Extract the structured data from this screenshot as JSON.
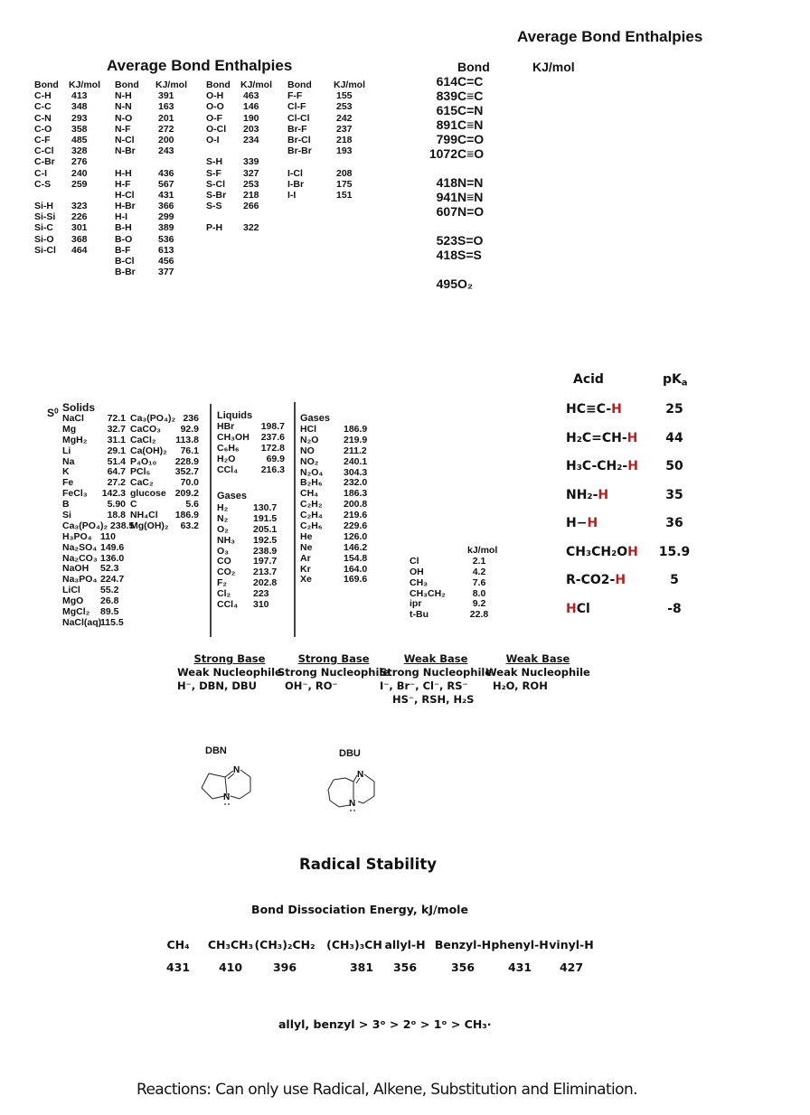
{
  "bond_enthalpies_single": {
    "title": "Average Bond Enthalpies",
    "header_bond": "Bond",
    "header_value": "KJ/mol",
    "columns": [
      {
        "groups": [
          [
            [
              "C-H",
              "413"
            ],
            [
              "C-C",
              "348"
            ],
            [
              "C-N",
              "293"
            ],
            [
              "C-O",
              "358"
            ],
            [
              "C-F",
              "485"
            ],
            [
              "C-Cl",
              "328"
            ],
            [
              "C-Br",
              "276"
            ],
            [
              "C-I",
              "240"
            ],
            [
              "C-S",
              "259"
            ]
          ],
          [
            [
              "Si-H",
              "323"
            ],
            [
              "Si-Si",
              "226"
            ],
            [
              "Si-C",
              "301"
            ],
            [
              "Si-O",
              "368"
            ],
            [
              "Si-Cl",
              "464"
            ]
          ]
        ]
      },
      {
        "groups": [
          [
            [
              "N-H",
              "391"
            ],
            [
              "N-N",
              "163"
            ],
            [
              "N-O",
              "201"
            ],
            [
              "N-F",
              "272"
            ],
            [
              "N-Cl",
              "200"
            ],
            [
              "N-Br",
              "243"
            ]
          ],
          [
            [
              "H-H",
              "436"
            ],
            [
              "H-F",
              "567"
            ],
            [
              "H-Cl",
              "431"
            ],
            [
              "H-Br",
              "366"
            ],
            [
              "H-I",
              "299"
            ],
            [
              "B-H",
              "389"
            ],
            [
              "B-O",
              "536"
            ],
            [
              "B-F",
              "613"
            ],
            [
              "B-Cl",
              "456"
            ],
            [
              "B-Br",
              "377"
            ]
          ]
        ]
      },
      {
        "groups": [
          [
            [
              "O-H",
              "463"
            ],
            [
              "O-O",
              "146"
            ],
            [
              "O-F",
              "190"
            ],
            [
              "O-Cl",
              "203"
            ],
            [
              "O-I",
              "234"
            ]
          ],
          [
            [
              "S-H",
              "339"
            ],
            [
              "S-F",
              "327"
            ],
            [
              "S-Cl",
              "253"
            ],
            [
              "S-Br",
              "218"
            ],
            [
              "S-S",
              "266"
            ]
          ],
          [
            [
              "P-H",
              "322"
            ]
          ]
        ]
      },
      {
        "groups": [
          [
            [
              "F-F",
              "155"
            ],
            [
              "Cl-F",
              "253"
            ],
            [
              "Cl-Cl",
              "242"
            ],
            [
              "Br-F",
              "237"
            ],
            [
              "Br-Cl",
              "218"
            ],
            [
              "Br-Br",
              "193"
            ]
          ],
          [
            [
              "I-Cl",
              "208"
            ],
            [
              "I-Br",
              "175"
            ],
            [
              "I-I",
              "151"
            ]
          ]
        ]
      }
    ]
  },
  "bond_enthalpies_multiple": {
    "title": "Average Bond Enthalpies",
    "header_bond": "Bond",
    "header_value": "KJ/mol",
    "groups": [
      [
        [
          "C=C",
          "614"
        ],
        [
          "C≡C",
          "839"
        ],
        [
          "C=N",
          "615"
        ],
        [
          "C≡N",
          "891"
        ],
        [
          "C=O",
          "799"
        ],
        [
          "C≡O",
          "1072"
        ]
      ],
      [
        [
          "N=N",
          "418"
        ],
        [
          "N≡N",
          "941"
        ],
        [
          "N=O",
          "607"
        ]
      ],
      [
        [
          "S=O",
          "523"
        ],
        [
          "S=S",
          "418"
        ]
      ],
      [
        [
          "O₂",
          "495"
        ]
      ]
    ]
  },
  "entropy": {
    "symbol": "S",
    "symbol_sup": "0",
    "solids": {
      "label": "Solids",
      "col1": [
        [
          "NaCl",
          "72.1"
        ],
        [
          "Mg",
          "32.7"
        ],
        [
          "MgH₂",
          "31.1"
        ],
        [
          "Li",
          "29.1"
        ],
        [
          "Na",
          "51.4"
        ],
        [
          "K",
          "64.7"
        ],
        [
          "Fe",
          "27.2"
        ],
        [
          "FeCl₃",
          "142.3"
        ],
        [
          "B",
          "5.90"
        ],
        [
          "Si",
          "18.8"
        ]
      ],
      "col2": [
        [
          "Ca₃(PO₄)₂",
          "236"
        ],
        [
          "CaCO₃",
          "92.9"
        ],
        [
          "CaCl₂",
          "113.8"
        ],
        [
          "Ca(OH)₂",
          "76.1"
        ],
        [
          "P₄O₁₀",
          "228.9"
        ],
        [
          "PCl₅",
          "352.7"
        ],
        [
          "CaC₂",
          "70.0"
        ],
        [
          "glucose",
          "209.2"
        ],
        [
          "C",
          "5.6"
        ],
        [
          "NH₄Cl",
          "186.9"
        ]
      ],
      "wide_row": [
        "Ca₃(PO₄)₂",
        "238.5",
        "Mg(OH)₂",
        "63.2"
      ],
      "tail": [
        [
          "H₃PO₄",
          "110"
        ],
        [
          "Na₂SO₄",
          "149.6"
        ],
        [
          "Na₂CO₃",
          "136.0"
        ],
        [
          "NaOH",
          "52.3"
        ],
        [
          "Na₃PO₄",
          "224.7"
        ],
        [
          "LiCl",
          "55.2"
        ],
        [
          "MgO",
          "26.8"
        ],
        [
          "MgCl₂",
          "89.5"
        ],
        [
          "NaCl(aq)",
          "115.5"
        ]
      ]
    },
    "liquids": {
      "label": "Liquids",
      "rows": [
        [
          "HBr",
          "198.7"
        ],
        [
          "CH₃OH",
          "237.6"
        ],
        [
          "C₆H₆",
          "172.8"
        ],
        [
          "H₂O",
          "69.9"
        ],
        [
          "CCl₄",
          "216.3"
        ]
      ]
    },
    "gases1": {
      "label": "Gases",
      "rows": [
        [
          "H₂",
          "130.7"
        ],
        [
          "N₂",
          "191.5"
        ],
        [
          "O₂",
          "205.1"
        ],
        [
          "NH₃",
          "192.5"
        ],
        [
          "O₃",
          "238.9"
        ],
        [
          "CO",
          "197.7"
        ],
        [
          "CO₂",
          "213.7"
        ],
        [
          "F₂",
          "202.8"
        ],
        [
          "Cl₂",
          "223"
        ],
        [
          "CCl₄",
          "310"
        ]
      ]
    },
    "gases2": {
      "label": "Gases",
      "rows": [
        [
          "HCl",
          "186.9"
        ],
        [
          "N₂O",
          "219.9"
        ],
        [
          "NO",
          "211.2"
        ],
        [
          "NO₂",
          "240.1"
        ],
        [
          "N₂O₄",
          "304.3"
        ],
        [
          "B₂H₆",
          "232.0"
        ],
        [
          "CH₄",
          "186.3"
        ],
        [
          "C₂H₂",
          "200.8"
        ],
        [
          "C₂H₄",
          "219.6"
        ],
        [
          "C₂H₆",
          "229.6"
        ],
        [
          "He",
          "126.0"
        ],
        [
          "Ne",
          "146.2"
        ],
        [
          "Ar",
          "154.8"
        ],
        [
          "Kr",
          "164.0"
        ],
        [
          "Xe",
          "169.6"
        ]
      ]
    }
  },
  "substituent_energies": {
    "unit": "kJ/mol",
    "rows": [
      [
        "Cl",
        "2.1"
      ],
      [
        "OH",
        "4.2"
      ],
      [
        "CH₃",
        "7.6"
      ],
      [
        "CH₃CH₂",
        "8.0"
      ],
      [
        "ipr",
        "9.2"
      ],
      [
        "t-Bu",
        "22.8"
      ]
    ]
  },
  "pka_table": {
    "header_acid": "Acid",
    "header_pka": "pK",
    "header_pka_sub": "a",
    "accent_color": "#b22222",
    "rows": [
      {
        "acid_prefix": "HC≡C-",
        "acid_h": "H",
        "acid_suffix": "",
        "pka": "25"
      },
      {
        "acid_prefix": "H₂C=CH-",
        "acid_h": "H",
        "acid_suffix": "",
        "pka": "44"
      },
      {
        "acid_prefix": "H₃C-CH₂-",
        "acid_h": "H",
        "acid_suffix": "",
        "pka": "50"
      },
      {
        "acid_prefix": "NH₂-",
        "acid_h": "H",
        "acid_suffix": "",
        "pka": "35"
      },
      {
        "acid_prefix": "H−",
        "acid_h": "H",
        "acid_suffix": "",
        "pka": "36"
      },
      {
        "acid_prefix": "CH₃CH₂O",
        "acid_h": "H",
        "acid_suffix": "",
        "pka": "15.9"
      },
      {
        "acid_prefix": "R-CO2-",
        "acid_h": "H",
        "acid_suffix": "",
        "pka": "5"
      },
      {
        "acid_prefix": "",
        "acid_h": "H",
        "acid_suffix": "Cl",
        "pka": "-8"
      }
    ]
  },
  "base_nucleophile": [
    {
      "heading": "Strong Base",
      "sub": "Weak Nucleophile",
      "examples": [
        "H⁻, DBN, DBU"
      ]
    },
    {
      "heading": "Strong Base",
      "sub": "Strong Nucleophile",
      "examples": [
        "OH⁻, RO⁻"
      ]
    },
    {
      "heading": "Weak Base",
      "sub": "Strong Nucleophile",
      "examples": [
        "I⁻, Br⁻, Cl⁻, RS⁻",
        "HS⁻, RSH, H₂S"
      ]
    },
    {
      "heading": "Weak Base",
      "sub": "Weak Nucleophile",
      "examples": [
        "H₂O, ROH"
      ]
    }
  ],
  "molecules": {
    "dbn_label": "DBN",
    "dbu_label": "DBU",
    "atom_n": "N"
  },
  "radical": {
    "title": "Radical Stability",
    "bde_title": "Bond Dissociation Energy, kJ/mole",
    "species": [
      "CH₄",
      "CH₃CH₃",
      "(CH₃)₂CH₂",
      "(CH₃)₃CH",
      "allyl-H",
      "Benzyl-H",
      "phenyl-H",
      "vinyl-H"
    ],
    "values": [
      "431",
      "410",
      "396",
      "381",
      "356",
      "356",
      "431",
      "427"
    ],
    "order": "allyl, benzyl > 3ᵒ > 2ᵒ > 1ᵒ > CH₃·"
  },
  "footer": "Reactions: Can only use Radical, Alkene, Substitution and Elimination."
}
